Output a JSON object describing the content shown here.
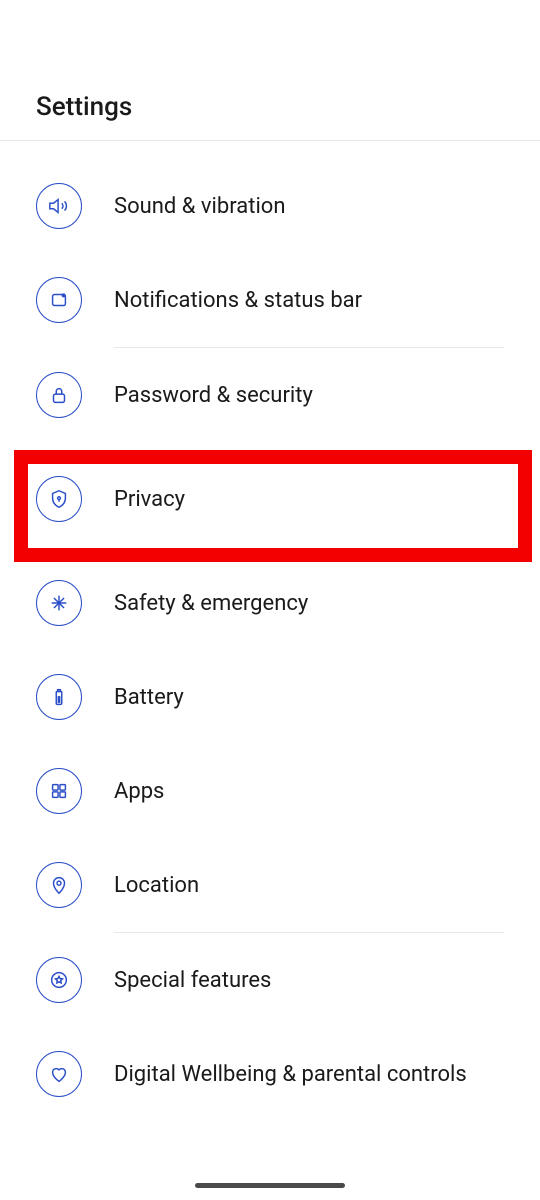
{
  "header": {
    "title": "Settings"
  },
  "items": [
    {
      "id": "sound",
      "label": "Sound & vibration"
    },
    {
      "id": "notifications",
      "label": "Notifications & status bar"
    },
    {
      "id": "password",
      "label": "Password & security"
    },
    {
      "id": "privacy",
      "label": "Privacy"
    },
    {
      "id": "safety",
      "label": "Safety & emergency"
    },
    {
      "id": "battery",
      "label": "Battery"
    },
    {
      "id": "apps",
      "label": "Apps"
    },
    {
      "id": "location",
      "label": "Location"
    },
    {
      "id": "special",
      "label": "Special features"
    },
    {
      "id": "wellbeing",
      "label": "Digital Wellbeing & parental controls"
    }
  ],
  "colors": {
    "accent": "#2b4fc7",
    "highlight": "#f20000"
  }
}
